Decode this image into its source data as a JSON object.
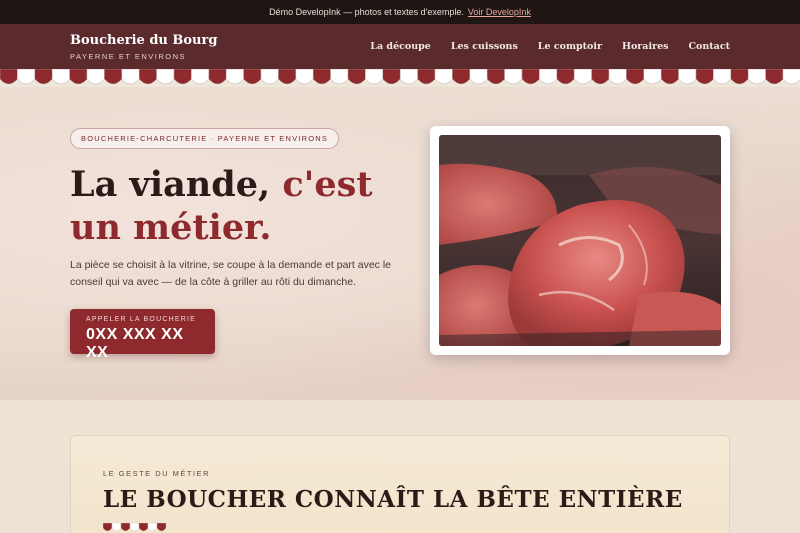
{
  "demo_bar": {
    "text": "Démo DevelopInk — photos et textes d'exemple.",
    "link": "Voir DevelopInk"
  },
  "header": {
    "brand_name": "Boucherie du Bourg",
    "brand_sub": "PAYERNE ET ENVIRONS",
    "nav": [
      "La découpe",
      "Les cuissons",
      "Le comptoir",
      "Horaires",
      "Contact"
    ]
  },
  "hero": {
    "tag": "BOUCHERIE-CHARCUTERIE · PAYERNE ET ENVIRONS",
    "headline_plain": "La viande, ",
    "headline_accent_1": "c'est",
    "headline_accent_2": "un métier.",
    "lead": "La pièce se choisit à la vitrine, se coupe à la demande et part avec le conseil qui va avec — de la côte à griller au rôti du dimanche.",
    "cta_label": "APPELER LA BOUCHERIE",
    "cta_phone": "0XX XXX XX XX"
  },
  "section": {
    "eyebrow": "LE GESTE DU MÉTIER",
    "title": "LE BOUCHER CONNAÎT LA BÊTE ENTIÈRE"
  },
  "colors": {
    "accent": "#8e2a2e",
    "header_bg": "#5a2a2c",
    "demo_bg": "#1f1513"
  },
  "icons": {
    "awning": "striped-awning-decoration"
  }
}
